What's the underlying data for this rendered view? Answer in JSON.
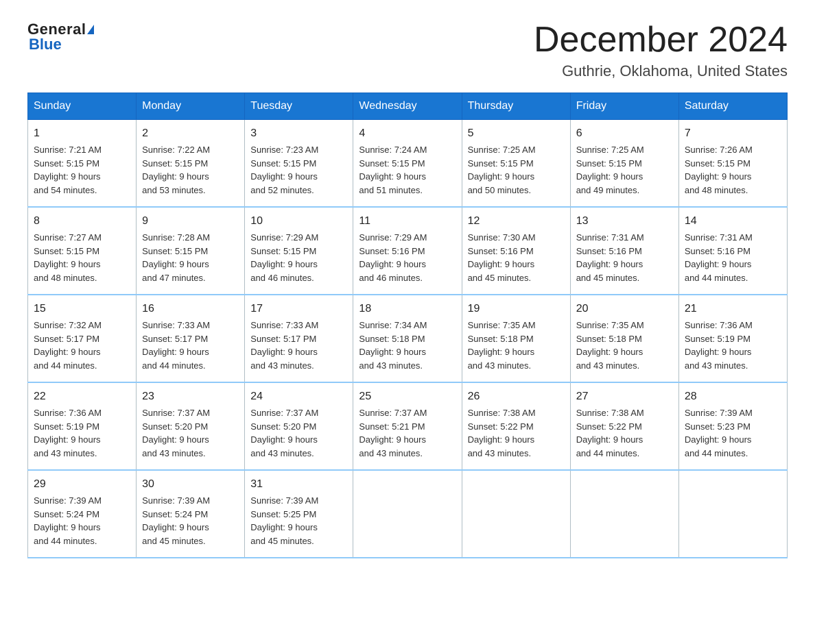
{
  "header": {
    "logo_general": "General",
    "logo_blue": "Blue",
    "month_title": "December 2024",
    "location": "Guthrie, Oklahoma, United States"
  },
  "days_of_week": [
    "Sunday",
    "Monday",
    "Tuesday",
    "Wednesday",
    "Thursday",
    "Friday",
    "Saturday"
  ],
  "weeks": [
    [
      {
        "day": "1",
        "sunrise": "7:21 AM",
        "sunset": "5:15 PM",
        "daylight": "9 hours and 54 minutes."
      },
      {
        "day": "2",
        "sunrise": "7:22 AM",
        "sunset": "5:15 PM",
        "daylight": "9 hours and 53 minutes."
      },
      {
        "day": "3",
        "sunrise": "7:23 AM",
        "sunset": "5:15 PM",
        "daylight": "9 hours and 52 minutes."
      },
      {
        "day": "4",
        "sunrise": "7:24 AM",
        "sunset": "5:15 PM",
        "daylight": "9 hours and 51 minutes."
      },
      {
        "day": "5",
        "sunrise": "7:25 AM",
        "sunset": "5:15 PM",
        "daylight": "9 hours and 50 minutes."
      },
      {
        "day": "6",
        "sunrise": "7:25 AM",
        "sunset": "5:15 PM",
        "daylight": "9 hours and 49 minutes."
      },
      {
        "day": "7",
        "sunrise": "7:26 AM",
        "sunset": "5:15 PM",
        "daylight": "9 hours and 48 minutes."
      }
    ],
    [
      {
        "day": "8",
        "sunrise": "7:27 AM",
        "sunset": "5:15 PM",
        "daylight": "9 hours and 48 minutes."
      },
      {
        "day": "9",
        "sunrise": "7:28 AM",
        "sunset": "5:15 PM",
        "daylight": "9 hours and 47 minutes."
      },
      {
        "day": "10",
        "sunrise": "7:29 AM",
        "sunset": "5:15 PM",
        "daylight": "9 hours and 46 minutes."
      },
      {
        "day": "11",
        "sunrise": "7:29 AM",
        "sunset": "5:16 PM",
        "daylight": "9 hours and 46 minutes."
      },
      {
        "day": "12",
        "sunrise": "7:30 AM",
        "sunset": "5:16 PM",
        "daylight": "9 hours and 45 minutes."
      },
      {
        "day": "13",
        "sunrise": "7:31 AM",
        "sunset": "5:16 PM",
        "daylight": "9 hours and 45 minutes."
      },
      {
        "day": "14",
        "sunrise": "7:31 AM",
        "sunset": "5:16 PM",
        "daylight": "9 hours and 44 minutes."
      }
    ],
    [
      {
        "day": "15",
        "sunrise": "7:32 AM",
        "sunset": "5:17 PM",
        "daylight": "9 hours and 44 minutes."
      },
      {
        "day": "16",
        "sunrise": "7:33 AM",
        "sunset": "5:17 PM",
        "daylight": "9 hours and 44 minutes."
      },
      {
        "day": "17",
        "sunrise": "7:33 AM",
        "sunset": "5:17 PM",
        "daylight": "9 hours and 43 minutes."
      },
      {
        "day": "18",
        "sunrise": "7:34 AM",
        "sunset": "5:18 PM",
        "daylight": "9 hours and 43 minutes."
      },
      {
        "day": "19",
        "sunrise": "7:35 AM",
        "sunset": "5:18 PM",
        "daylight": "9 hours and 43 minutes."
      },
      {
        "day": "20",
        "sunrise": "7:35 AM",
        "sunset": "5:18 PM",
        "daylight": "9 hours and 43 minutes."
      },
      {
        "day": "21",
        "sunrise": "7:36 AM",
        "sunset": "5:19 PM",
        "daylight": "9 hours and 43 minutes."
      }
    ],
    [
      {
        "day": "22",
        "sunrise": "7:36 AM",
        "sunset": "5:19 PM",
        "daylight": "9 hours and 43 minutes."
      },
      {
        "day": "23",
        "sunrise": "7:37 AM",
        "sunset": "5:20 PM",
        "daylight": "9 hours and 43 minutes."
      },
      {
        "day": "24",
        "sunrise": "7:37 AM",
        "sunset": "5:20 PM",
        "daylight": "9 hours and 43 minutes."
      },
      {
        "day": "25",
        "sunrise": "7:37 AM",
        "sunset": "5:21 PM",
        "daylight": "9 hours and 43 minutes."
      },
      {
        "day": "26",
        "sunrise": "7:38 AM",
        "sunset": "5:22 PM",
        "daylight": "9 hours and 43 minutes."
      },
      {
        "day": "27",
        "sunrise": "7:38 AM",
        "sunset": "5:22 PM",
        "daylight": "9 hours and 44 minutes."
      },
      {
        "day": "28",
        "sunrise": "7:39 AM",
        "sunset": "5:23 PM",
        "daylight": "9 hours and 44 minutes."
      }
    ],
    [
      {
        "day": "29",
        "sunrise": "7:39 AM",
        "sunset": "5:24 PM",
        "daylight": "9 hours and 44 minutes."
      },
      {
        "day": "30",
        "sunrise": "7:39 AM",
        "sunset": "5:24 PM",
        "daylight": "9 hours and 45 minutes."
      },
      {
        "day": "31",
        "sunrise": "7:39 AM",
        "sunset": "5:25 PM",
        "daylight": "9 hours and 45 minutes."
      },
      null,
      null,
      null,
      null
    ]
  ],
  "labels": {
    "sunrise": "Sunrise:",
    "sunset": "Sunset:",
    "daylight": "Daylight: 9 hours"
  }
}
